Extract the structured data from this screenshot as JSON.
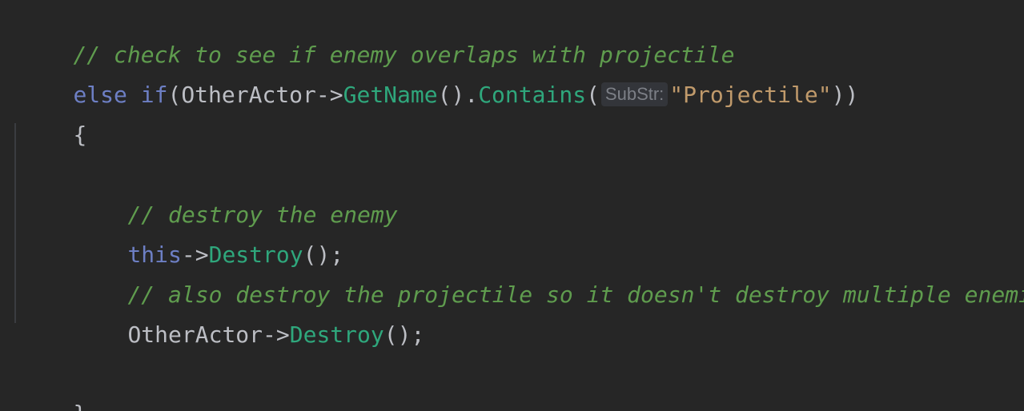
{
  "code": {
    "line1_comment": "// check to see if enemy overlaps with projectile",
    "line2": {
      "kw_else": "else",
      "kw_if": "if",
      "open_paren": "(",
      "object": "OtherActor",
      "arrow": "->",
      "fn_getname": "GetName",
      "call_dot": "().",
      "fn_contains": "Contains",
      "paren": "(",
      "param_hint": "SubStr:",
      "string_arg": "\"Projectile\"",
      "close": "))"
    },
    "line3_brace_open": "{",
    "line5_comment": "// destroy the enemy",
    "line6": {
      "kw_this": "this",
      "arrow": "->",
      "fn_destroy": "Destroy",
      "tail": "();"
    },
    "line7_comment": "// also destroy the projectile so it doesn't destroy multiple enemies",
    "line8": {
      "object": "OtherActor",
      "arrow": "->",
      "fn_destroy": "Destroy",
      "tail": "();"
    },
    "line10_brace_close": "}"
  },
  "colors": {
    "background": "#262626",
    "comment": "#5f9c4e",
    "keyword": "#6d7fc4",
    "function": "#2fa77c",
    "string": "#c09a6b",
    "text": "#bcbec4"
  }
}
